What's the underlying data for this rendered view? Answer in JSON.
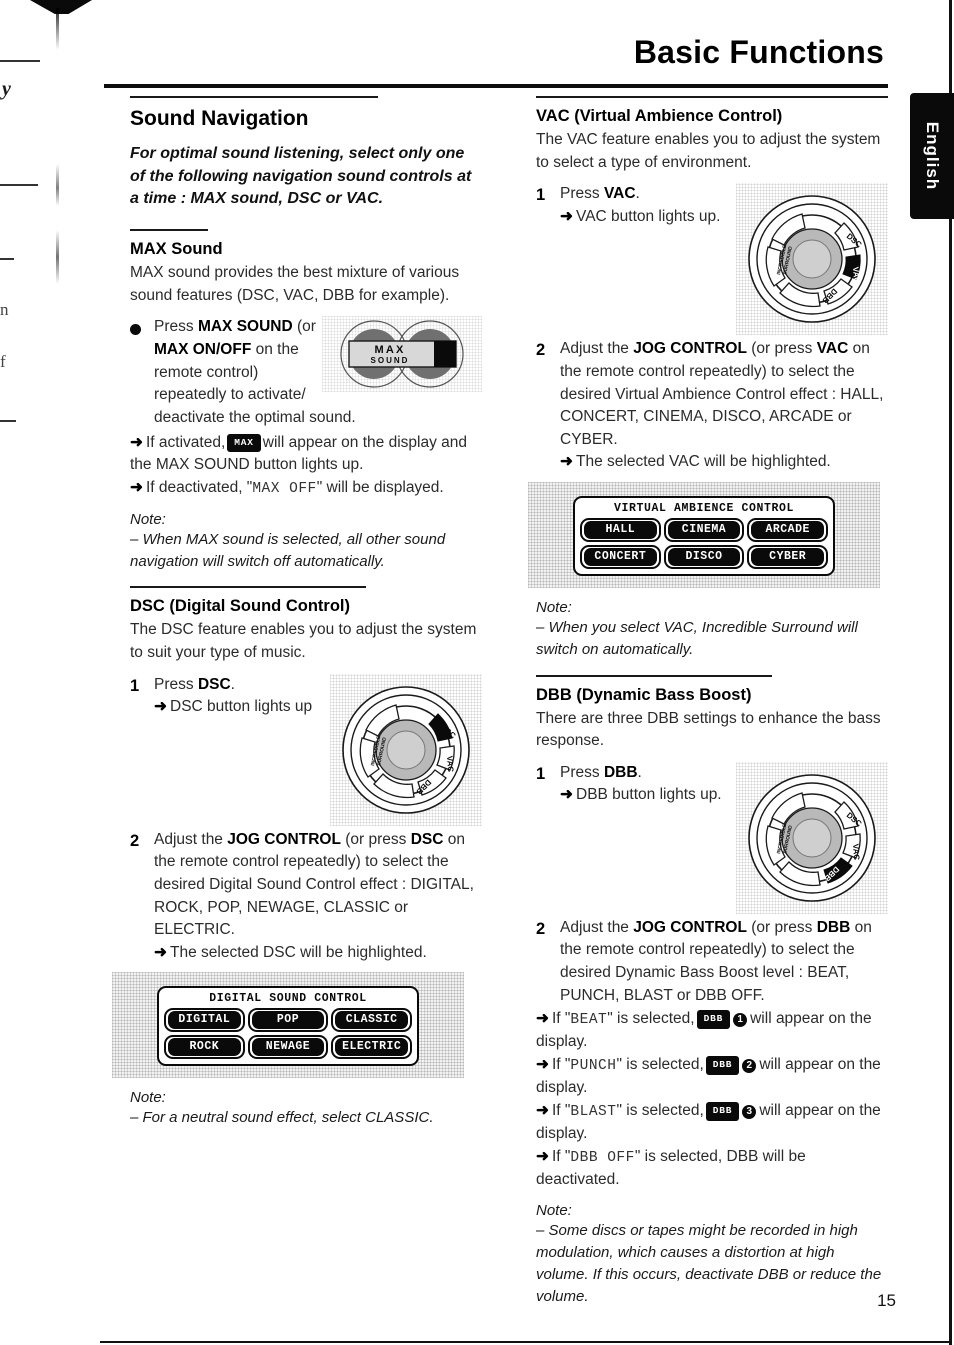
{
  "page": {
    "title": "Basic Functions",
    "language_tab": "English",
    "number": "15"
  },
  "left_column": {
    "section_title": "Sound Navigation",
    "lede": "For optimal sound listening, select only one of the following navigation sound controls at a time : MAX sound, DSC or VAC.",
    "max": {
      "heading": "MAX Sound",
      "intro": "MAX sound provides the best mixture of various sound features (DSC, VAC, DBB for example).",
      "step_text_1": "Press ",
      "step_bold_1": "MAX SOUND",
      "step_text_2": " (or ",
      "step_bold_2": "MAX ON/OFF",
      "step_text_3": " on the remote control) repeatedly to activate/ deactivate the optimal sound.",
      "arrow_1_a": "If activated,",
      "arrow_1_badge": "MAX",
      "arrow_1_b": "will appear on the display and the MAX SOUND button lights up.",
      "arrow_2_a": "If deactivated, \"",
      "arrow_2_lcd": "MAX OFF",
      "arrow_2_b": "\" will be displayed.",
      "note_label": "Note:",
      "note_text": "–  When MAX sound is selected, all other sound navigation will switch off automatically.",
      "logo_line_1": "MAX",
      "logo_line_2": "SOUND"
    },
    "dsc": {
      "heading": "DSC (Digital Sound Control)",
      "intro": "The DSC feature enables you to adjust the system to suit your type of music.",
      "step1_num": "1",
      "step1_text": "Press ",
      "step1_bold": "DSC",
      "step1_end": ".",
      "step1_arrow": "DSC button lights up",
      "step2_num": "2",
      "step2_a": "Adjust the ",
      "step2_b1": "JOG CONTROL",
      "step2_c": " (or press ",
      "step2_b2": "DSC",
      "step2_d": " on the remote control repeatedly) to select the desired Digital Sound Control effect : DIGITAL, ROCK, POP, NEWAGE, CLASSIC or ELECTRIC.",
      "step2_arrow": "The selected DSC will be highlighted.",
      "display": {
        "header": "DIGITAL SOUND CONTROL",
        "row1": [
          "DIGITAL",
          "POP",
          "CLASSIC"
        ],
        "row2": [
          "ROCK",
          "NEWAGE",
          "ELECTRIC"
        ]
      },
      "note_label": "Note:",
      "note_text": "–  For a neutral sound effect, select CLASSIC.",
      "dial_labels": [
        "DSC",
        "VAC",
        "DBB",
        "INCREDIBLE SURROUND"
      ]
    }
  },
  "right_column": {
    "vac": {
      "heading": "VAC (Virtual Ambience Control)",
      "intro": "The VAC feature enables you to adjust the system to select a type of environment.",
      "step1_num": "1",
      "step1_text": "Press ",
      "step1_bold": "VAC",
      "step1_end": ".",
      "step1_arrow": "VAC button lights up.",
      "step2_num": "2",
      "step2_a": "Adjust the ",
      "step2_b1": "JOG CONTROL",
      "step2_c": " (or press ",
      "step2_b2": "VAC",
      "step2_d": " on the remote control repeatedly) to select the desired Virtual Ambience Control effect : HALL, CONCERT, CINEMA, DISCO, ARCADE or CYBER.",
      "step2_arrow": "The selected VAC will be highlighted.",
      "display": {
        "header": "VIRTUAL AMBIENCE CONTROL",
        "row1": [
          "HALL",
          "CINEMA",
          "ARCADE"
        ],
        "row2": [
          "CONCERT",
          "DISCO",
          "CYBER"
        ]
      },
      "note_label": "Note:",
      "note_text": "–  When you select VAC, Incredible Surround will switch on automatically.",
      "dial_labels": [
        "DSC",
        "VAC",
        "DBB",
        "INCREDIBLE SURROUND"
      ]
    },
    "dbb": {
      "heading": "DBB (Dynamic Bass Boost)",
      "intro": "There are three DBB settings to enhance the bass response.",
      "step1_num": "1",
      "step1_text": "Press ",
      "step1_bold": "DBB",
      "step1_end": ".",
      "step1_arrow": "DBB button lights up.",
      "step2_num": "2",
      "step2_a": "Adjust the ",
      "step2_b1": "JOG CONTROL",
      "step2_c": " (or press ",
      "step2_b2": "DBB",
      "step2_d": " on the remote control repeatedly) to select the desired Dynamic Bass Boost level : BEAT, PUNCH, BLAST or DBB OFF.",
      "arrows": [
        {
          "pre": "If \"",
          "lcd": "BEAT",
          "mid": "\" is selected,",
          "badge": "DBB",
          "num": "1",
          "post": "will appear on the display."
        },
        {
          "pre": "If \"",
          "lcd": "PUNCH",
          "mid": "\" is selected,",
          "badge": "DBB",
          "num": "2",
          "post": "will appear on the display."
        },
        {
          "pre": "If \"",
          "lcd": "BLAST",
          "mid": "\" is selected,",
          "badge": "DBB",
          "num": "3",
          "post": "will appear on the display."
        },
        {
          "pre": "If \"",
          "lcd": "DBB OFF",
          "mid": "\" is selected, DBB will be",
          "badge": "",
          "num": "",
          "post": "deactivated."
        }
      ],
      "note_label": "Note:",
      "note_text": "–  Some discs or tapes might be recorded in high modulation, which causes a distortion at high volume. If this occurs, deactivate DBB or reduce the volume.",
      "dial_labels": [
        "DSC",
        "VAC",
        "DBB",
        "INCREDIBLE SURROUND"
      ]
    }
  },
  "scan_bleed": {
    "frag_1": "y",
    "frag_2": "n",
    "frag_3": "f"
  }
}
